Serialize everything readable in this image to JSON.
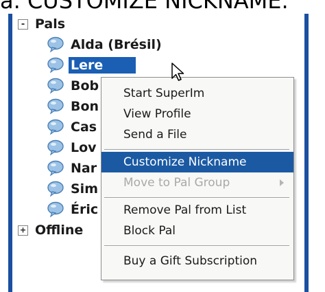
{
  "caption": "a. CUSTOMIZE NICKNAME.",
  "tree": {
    "groups": [
      {
        "expander": "-",
        "label": "Pals"
      },
      {
        "expander": "+",
        "label": "Offline"
      }
    ],
    "pals": [
      {
        "label": "Alda (Brésil)"
      },
      {
        "label": "Lere"
      },
      {
        "label": "Bob"
      },
      {
        "label": "Bon"
      },
      {
        "label": "Cas"
      },
      {
        "label": "Lov"
      },
      {
        "label": "Nar"
      },
      {
        "label": "Sim"
      },
      {
        "label": "Éric"
      }
    ]
  },
  "context_menu": {
    "items": [
      {
        "label": "Start SuperIm",
        "state": "normal"
      },
      {
        "label": "View Profile",
        "state": "normal"
      },
      {
        "label": "Send a File",
        "state": "normal"
      },
      {
        "label": "Customize Nickname",
        "state": "highlighted"
      },
      {
        "label": "Move to Pal Group",
        "state": "disabled"
      },
      {
        "label": "Remove Pal from List",
        "state": "normal"
      },
      {
        "label": "Block Pal",
        "state": "normal"
      },
      {
        "label": "Buy a Gift Subscription",
        "state": "normal"
      }
    ]
  },
  "colors": {
    "selection": "#1a5fb4",
    "menu_highlight": "#1b5aa3",
    "panel_border": "#1b4fa0",
    "disabled_text": "#a9a9a9"
  },
  "icons": {
    "pal": "chat-bubble-icon",
    "submenu": "submenu-arrow-icon",
    "cursor": "mouse-pointer-icon"
  }
}
